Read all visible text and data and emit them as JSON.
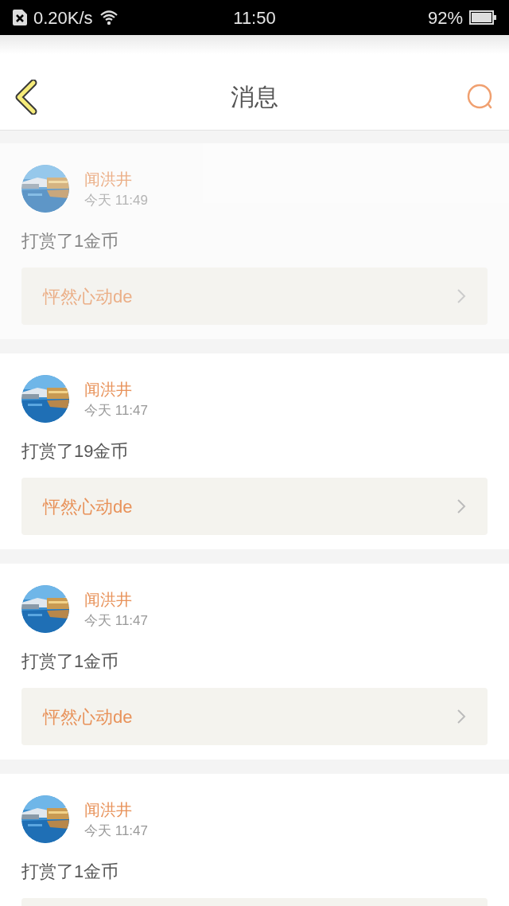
{
  "status_bar": {
    "speed": "0.20K/s",
    "time": "11:50",
    "battery": "92%"
  },
  "header": {
    "title": "消息"
  },
  "messages": [
    {
      "name": "闻洪井",
      "time": "今天 11:49",
      "text": "打赏了1金币",
      "link": "怦然心动de",
      "faded": true
    },
    {
      "name": "闻洪井",
      "time": "今天 11:47",
      "text": "打赏了19金币",
      "link": "怦然心动de",
      "faded": false
    },
    {
      "name": "闻洪井",
      "time": "今天 11:47",
      "text": "打赏了1金币",
      "link": "怦然心动de",
      "faded": false
    },
    {
      "name": "闻洪井",
      "time": "今天 11:47",
      "text": "打赏了1金币",
      "faded": false
    }
  ]
}
